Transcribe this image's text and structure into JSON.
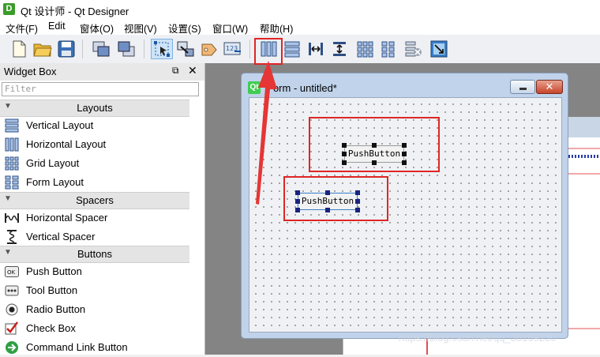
{
  "window": {
    "title": "Qt 设计师 - Qt Designer",
    "icon": "D"
  },
  "menu": [
    "文件(F)",
    "Edit",
    "窗体(O)",
    "视图(V)",
    "设置(S)",
    "窗口(W)",
    "帮助(H)"
  ],
  "toolbar": {
    "icons": [
      "new-file-icon",
      "open-folder-icon",
      "save-icon",
      "send-to-back-icon",
      "bring-to-front-icon",
      "edit-widgets-icon",
      "edit-signals-slots-icon",
      "edit-buddies-icon",
      "edit-tab-order-icon",
      "layout-horizontal-icon",
      "layout-vertical-icon",
      "layout-horizontal-splitter-icon",
      "layout-vertical-splitter-icon",
      "layout-grid-icon",
      "layout-form-icon",
      "break-layout-icon",
      "adjust-size-icon"
    ]
  },
  "widget_box": {
    "title": "Widget Box",
    "filter_placeholder": "Filter",
    "categories": [
      {
        "name": "Layouts",
        "items": [
          "Vertical Layout",
          "Horizontal Layout",
          "Grid Layout",
          "Form Layout"
        ]
      },
      {
        "name": "Spacers",
        "items": [
          "Horizontal Spacer",
          "Vertical Spacer"
        ]
      },
      {
        "name": "Buttons",
        "items": [
          "Push Button",
          "Tool Button",
          "Radio Button",
          "Check Box",
          "Command Link Button"
        ]
      }
    ]
  },
  "form": {
    "title": "Form - untitled*",
    "icon": "Qt",
    "buttons": [
      "PushButton",
      "PushButton"
    ]
  },
  "watermark": "https://blog.csdn.net/qq_38169230",
  "colors": {
    "highlight": "#e02525",
    "qt_green": "#41cd52",
    "mdi_bg": "#848484"
  }
}
